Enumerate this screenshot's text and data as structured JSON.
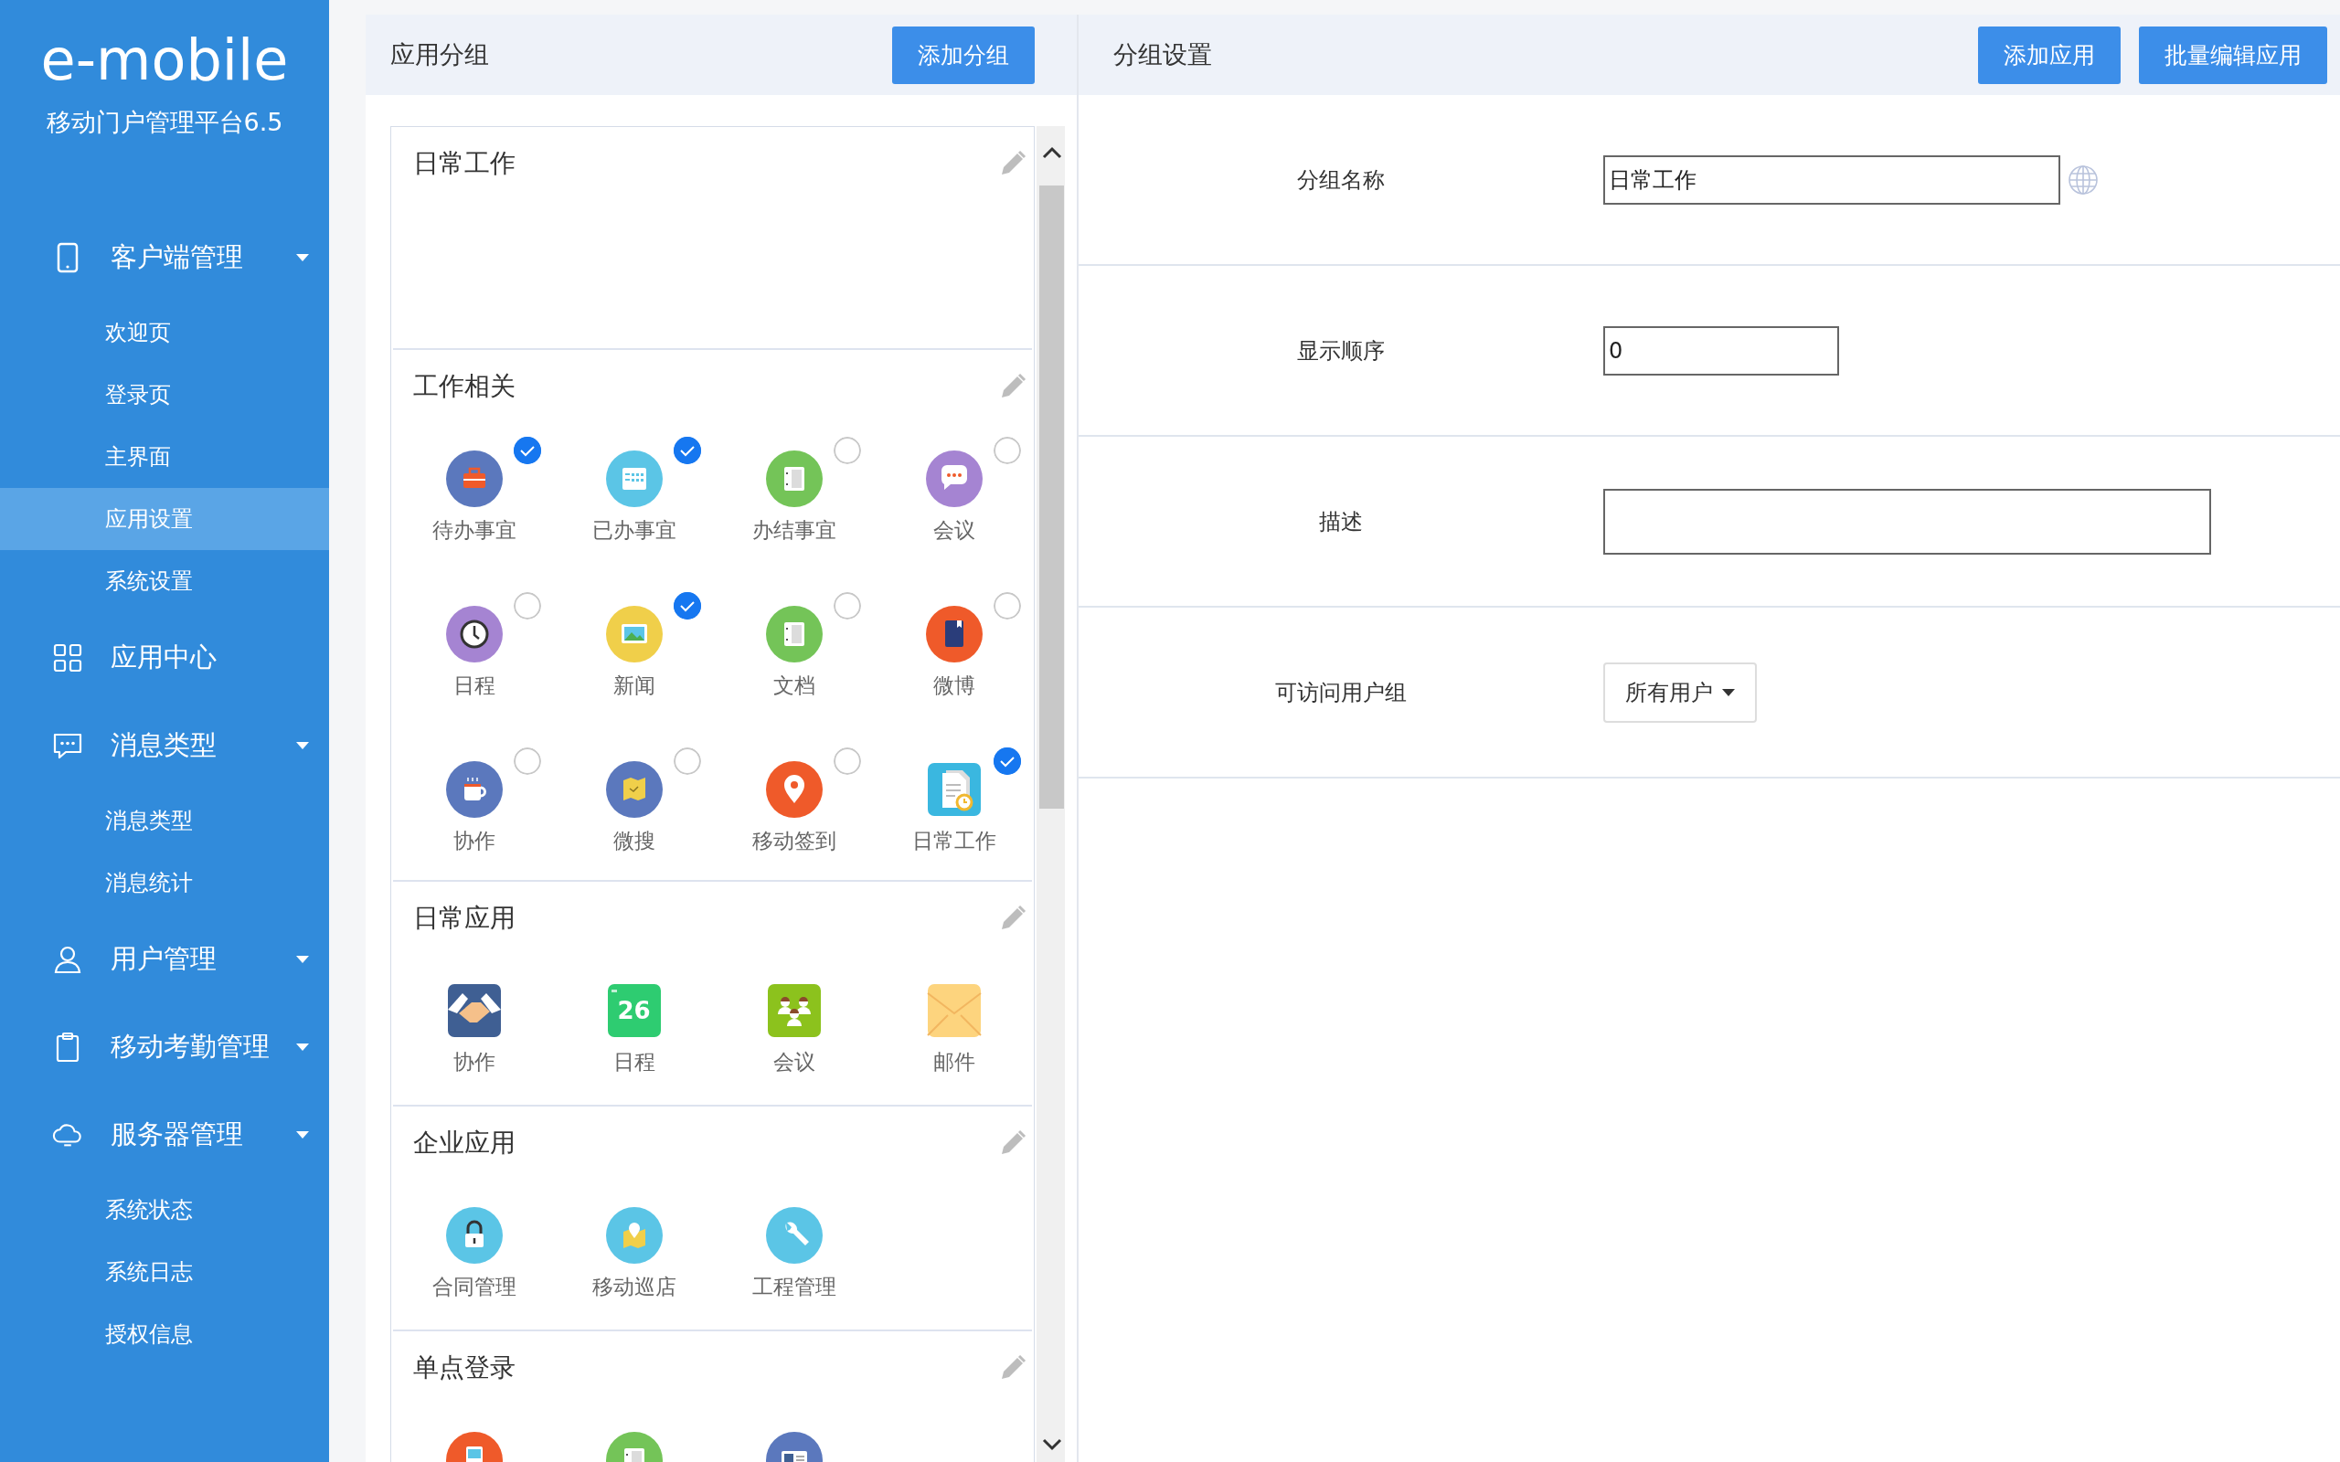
{
  "sidebar": {
    "logo": "e-mobile",
    "subtitle": "移动门户管理平台6.5",
    "nav": [
      {
        "label": "客户端管理",
        "collapsible": true,
        "children": [
          {
            "label": "欢迎页",
            "selected": false
          },
          {
            "label": "登录页",
            "selected": false
          },
          {
            "label": "主界面",
            "selected": false
          },
          {
            "label": "应用设置",
            "selected": true
          },
          {
            "label": "系统设置",
            "selected": false
          }
        ]
      },
      {
        "label": "应用中心",
        "collapsible": false
      },
      {
        "label": "消息类型",
        "collapsible": true,
        "children": [
          {
            "label": "消息类型",
            "selected": false
          },
          {
            "label": "消息统计",
            "selected": false
          }
        ]
      },
      {
        "label": "用户管理",
        "collapsible": true
      },
      {
        "label": "移动考勤管理",
        "collapsible": true
      },
      {
        "label": "服务器管理",
        "collapsible": true,
        "children": [
          {
            "label": "系统状态",
            "selected": false
          },
          {
            "label": "系统日志",
            "selected": false
          },
          {
            "label": "授权信息",
            "selected": false
          }
        ]
      }
    ]
  },
  "groups_panel": {
    "title": "应用分组",
    "button": "添加分组",
    "groups": [
      {
        "name": "日常工作"
      },
      {
        "name": "工作相关",
        "items": [
          {
            "label": "待办事宜",
            "checked": true
          },
          {
            "label": "已办事宜",
            "checked": true
          },
          {
            "label": "办结事宜",
            "checked": false
          },
          {
            "label": "会议",
            "checked": false
          },
          {
            "label": "日程",
            "checked": false
          },
          {
            "label": "新闻",
            "checked": true
          },
          {
            "label": "文档",
            "checked": false
          },
          {
            "label": "微博",
            "checked": false
          },
          {
            "label": "协作",
            "checked": false
          },
          {
            "label": "微搜",
            "checked": false
          },
          {
            "label": "移动签到",
            "checked": false
          },
          {
            "label": "日常工作",
            "checked": true
          }
        ]
      },
      {
        "name": "日常应用",
        "items": [
          {
            "label": "协作"
          },
          {
            "label": "日程",
            "icon_text": "26"
          },
          {
            "label": "会议"
          },
          {
            "label": "邮件"
          }
        ]
      },
      {
        "name": "企业应用",
        "items": [
          {
            "label": "合同管理"
          },
          {
            "label": "移动巡店"
          },
          {
            "label": "工程管理"
          }
        ]
      },
      {
        "name": "单点登录"
      }
    ]
  },
  "settings": {
    "title": "分组设置",
    "buttons": [
      "添加应用",
      "批量编辑应用"
    ],
    "fields": [
      {
        "kind": "name",
        "label": "分组名称",
        "value": "日常工作"
      },
      {
        "kind": "number",
        "label": "显示顺序",
        "value": "0"
      },
      {
        "kind": "textarea",
        "label": "描述"
      },
      {
        "kind": "dropdown",
        "label": "可访问用户组",
        "value": "所有用户"
      }
    ]
  }
}
